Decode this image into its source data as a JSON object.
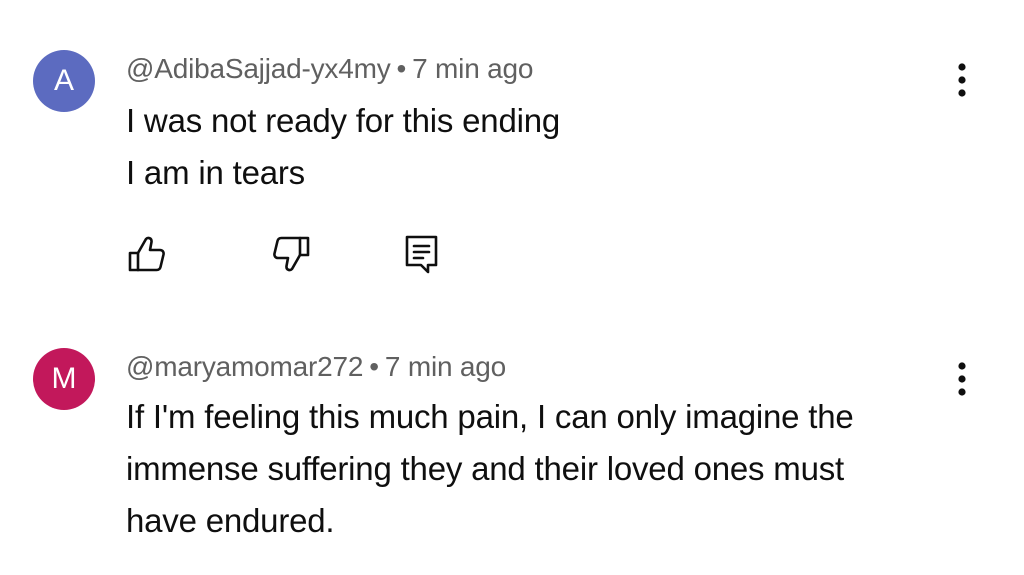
{
  "comments": [
    {
      "avatar_letter": "A",
      "avatar_color": "#5c6bc0",
      "handle": "@AdibaSajjad-yx4my",
      "separator": "•",
      "time": "7 min ago",
      "lines": [
        "I was not ready for this ending",
        "I am in tears"
      ],
      "actions": [
        "like-icon",
        "dislike-icon",
        "reply-icon"
      ],
      "menu_icon": "more-vertical-icon"
    },
    {
      "avatar_letter": "M",
      "avatar_color": "#c2185b",
      "handle": "@maryamomar272",
      "separator": "•",
      "time": "7 min ago",
      "lines": [
        "If I'm feeling this much pain, I can only imagine the",
        "immense suffering they and their loved ones must",
        "have endured."
      ],
      "menu_icon": "more-vertical-icon"
    }
  ]
}
